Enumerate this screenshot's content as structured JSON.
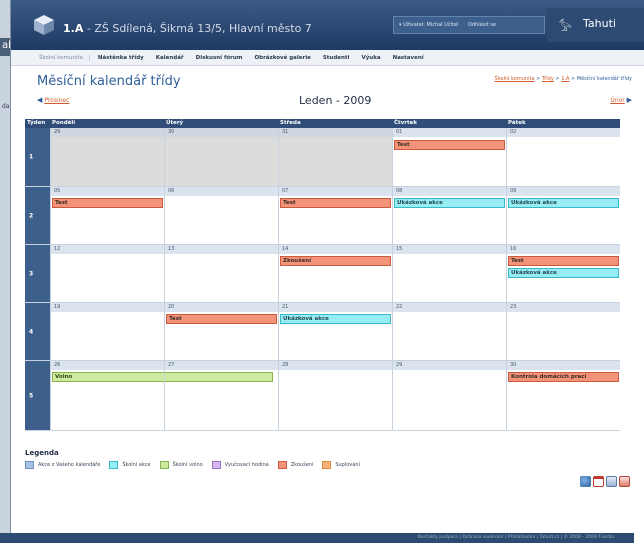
{
  "background_window": {
    "title_fragment": "ah",
    "side_text": "da"
  },
  "app": {
    "class_name": "1.A",
    "school": " - ZŠ Sdílená, Šikmá 13/5, Hlavní město 7",
    "user_label": "▾ Uživatel: Michal Učitel",
    "logout": "Odhlásit se",
    "brand": "Tahuti"
  },
  "nav": {
    "home": "Školní komunita",
    "items": [
      "Nástěnka třídy",
      "Kalendář",
      "Diskusní fórum",
      "Obrázkové galerie",
      "Studenti",
      "Výuka",
      "Nastavení"
    ]
  },
  "page": {
    "title": "Měsíční kalendář třídy",
    "breadcrumb": [
      "Školní komunita",
      "Třídy",
      "1.A",
      "Měsíční kalendář třídy"
    ],
    "breadcrumb_sep": " > "
  },
  "month_nav": {
    "prev": "Prosinec",
    "current": "Leden - 2009",
    "next": "Únor"
  },
  "calendar": {
    "headers": [
      "Týden",
      "Pondělí",
      "Úterý",
      "Středa",
      "Čtvrtek",
      "Pátek"
    ],
    "weeks": [
      {
        "week": "1",
        "days": [
          "29",
          "30",
          "31",
          "01",
          "02"
        ]
      },
      {
        "week": "2",
        "days": [
          "05",
          "06",
          "07",
          "08",
          "09"
        ]
      },
      {
        "week": "3",
        "days": [
          "12",
          "13",
          "14",
          "15",
          "16"
        ]
      },
      {
        "week": "4",
        "days": [
          "19",
          "20",
          "21",
          "22",
          "23"
        ]
      },
      {
        "week": "5",
        "days": [
          "26",
          "27",
          "28",
          "29",
          "30"
        ]
      }
    ],
    "events": {
      "w1_thu": "Test",
      "w2_mon": "Test",
      "w2_wed": "Test",
      "w2_thu": "Ukázková akce",
      "w2_fri": "Ukázková akce",
      "w3_wed": "Zkoušení",
      "w3_fri_1": "Test",
      "w3_fri_2": "Ukázková akce",
      "w4_tue": "Test",
      "w4_wed": "Ukázková akce",
      "w5_mon": "Volno",
      "w5_fri": "Kontrola domácích prací"
    }
  },
  "legend": {
    "title": "Legenda",
    "items": [
      {
        "label": "Akce z Vašeho kalendáře",
        "color": "#a9c3e6"
      },
      {
        "label": "Školní akce",
        "color": "#98ecf4"
      },
      {
        "label": "Školní volno",
        "color": "#cdeaa0"
      },
      {
        "label": "Vyučovací hodina",
        "color": "#d4b8ee"
      },
      {
        "label": "Zkoušení",
        "color": "#f2937a"
      },
      {
        "label": "Suplování",
        "color": "#f6b27a"
      }
    ]
  },
  "footer": {
    "text": "Kontakty podpora | Ochrana soukromí | Přihlašování | Tahuti.cz | © 2008 - 2009 Tvorba"
  },
  "colors": {
    "header_blue": "#2f4d78",
    "accent_orange": "#d05a2a",
    "title_blue": "#2e5f9a"
  }
}
